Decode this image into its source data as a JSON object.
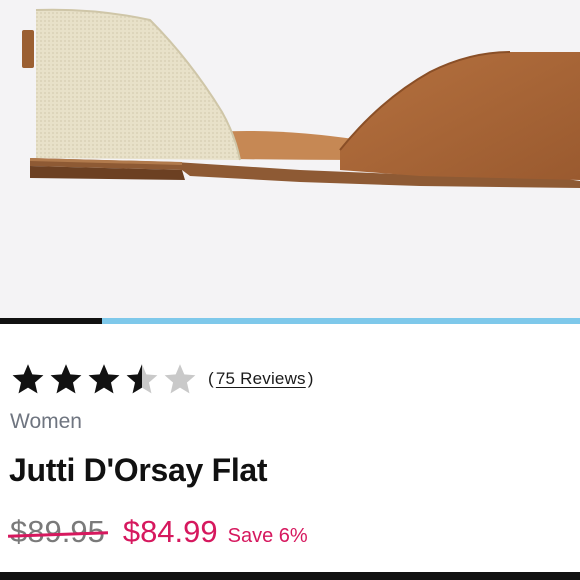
{
  "product": {
    "image_alt": "Jutti D'Orsay Flat shoe side view",
    "rating": 3.5,
    "rating_max": 5,
    "reviews_open": "(",
    "reviews_label": "75 Reviews",
    "reviews_close": ")",
    "category": "Women",
    "title": "Jutti D'Orsay Flat",
    "original_price": "$89.95",
    "sale_price": "$84.99",
    "savings": "Save 6%"
  },
  "gallery": {
    "progress": 0.175
  },
  "colors": {
    "accent": "#d6185e",
    "progress_track": "#7ec8ea",
    "star_filled": "#111111",
    "star_empty": "#c9c9c9"
  }
}
